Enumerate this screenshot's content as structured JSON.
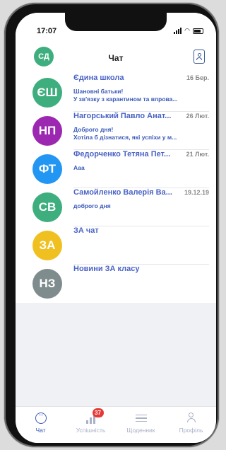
{
  "status": {
    "time": "17:07"
  },
  "header": {
    "avatar_initials": "СД",
    "avatar_color": "#3fae7e",
    "title": "Чат",
    "contacts_icon": "contact-book-icon"
  },
  "chats": [
    {
      "initials": "ЄШ",
      "color": "#3fae7e",
      "name": "Єдина школа",
      "date": "16 Бер.",
      "line1": "Шановні батьки!",
      "line2": "У зв'язку з карантином та впрова..."
    },
    {
      "initials": "НП",
      "color": "#9c27b0",
      "name": "Нагорський Павло Анат...",
      "date": "26 Лют.",
      "line1": "Доброго дня!",
      "line2": "Хотіла б дізнатися, які успіхи у м..."
    },
    {
      "initials": "ФТ",
      "color": "#2196f3",
      "name": "Федорченко Тетяна Пет...",
      "date": "21 Лют.",
      "line1": "Ааа",
      "line2": ""
    },
    {
      "initials": "СВ",
      "color": "#3fae7e",
      "name": "Самойленко Валерія Ва...",
      "date": "19.12.19",
      "line1": "доброго дня",
      "line2": ""
    },
    {
      "initials": "ЗА",
      "color": "#f0c020",
      "name": "ЗА чат",
      "date": "",
      "line1": "",
      "line2": ""
    },
    {
      "initials": "НЗ",
      "color": "#7f8c8d",
      "name": "Новини ЗА класу",
      "date": "",
      "line1": "",
      "line2": ""
    }
  ],
  "tabbar": {
    "tabs": [
      {
        "label": "Чат",
        "icon": "chat-bubble-icon",
        "active": true
      },
      {
        "label": "Успішність",
        "icon": "bar-chart-icon",
        "badge": "37"
      },
      {
        "label": "Щоденник",
        "icon": "list-icon"
      },
      {
        "label": "Профіль",
        "icon": "person-icon"
      }
    ]
  }
}
